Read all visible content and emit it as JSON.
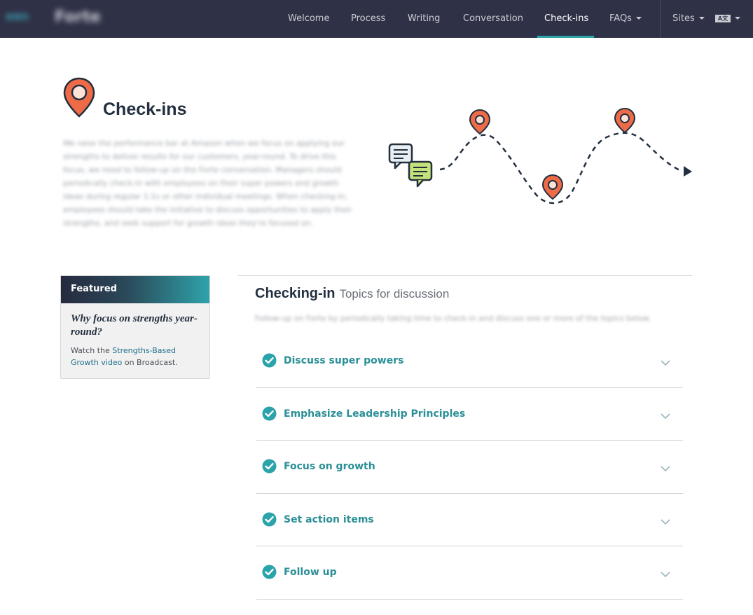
{
  "nav": {
    "brand_logo": "aws",
    "brand_name": "Forte",
    "items": [
      {
        "label": "Welcome"
      },
      {
        "label": "Process"
      },
      {
        "label": "Writing"
      },
      {
        "label": "Conversation"
      },
      {
        "label": "Check-ins",
        "active": true
      },
      {
        "label": "FAQs",
        "dropdown": true
      }
    ],
    "sites_label": "Sites",
    "language_icon": "translate-icon",
    "language_icon_text": "A文"
  },
  "hero": {
    "title": "Check-ins",
    "paragraph": "We raise the performance bar at Amazon when we focus on applying our strengths to deliver results for our customers, year-round. To drive this focus, we need to follow-up on the Forte conversation. Managers should periodically check-in with employees on their super powers and growth ideas during regular 1:1s or other individual meetings. When checking-in, employees should take the initiative to discuss opportunities to apply their strengths, and seek support for growth ideas they're focused on."
  },
  "featured": {
    "header": "Featured",
    "title": "Why focus on strengths year-round?",
    "text_before": "Watch the ",
    "link": "Strengths-Based Growth video",
    "text_after": " on Broadcast."
  },
  "checking_in": {
    "title": "Checking-in",
    "subtitle": "Topics for discussion",
    "description": "Follow-up on Forte by periodically taking time to check-in and discuss one or more of the topics below.",
    "topics": [
      {
        "label": "Discuss super powers"
      },
      {
        "label": "Emphasize Leadership Principles"
      },
      {
        "label": "Focus on growth"
      },
      {
        "label": "Set action items"
      },
      {
        "label": "Follow up"
      }
    ]
  },
  "colors": {
    "nav_bg": "#2f3146",
    "accent_teal": "#2ba3aa",
    "pin_orange": "#ee6b48",
    "text_dark": "#232f3e"
  }
}
